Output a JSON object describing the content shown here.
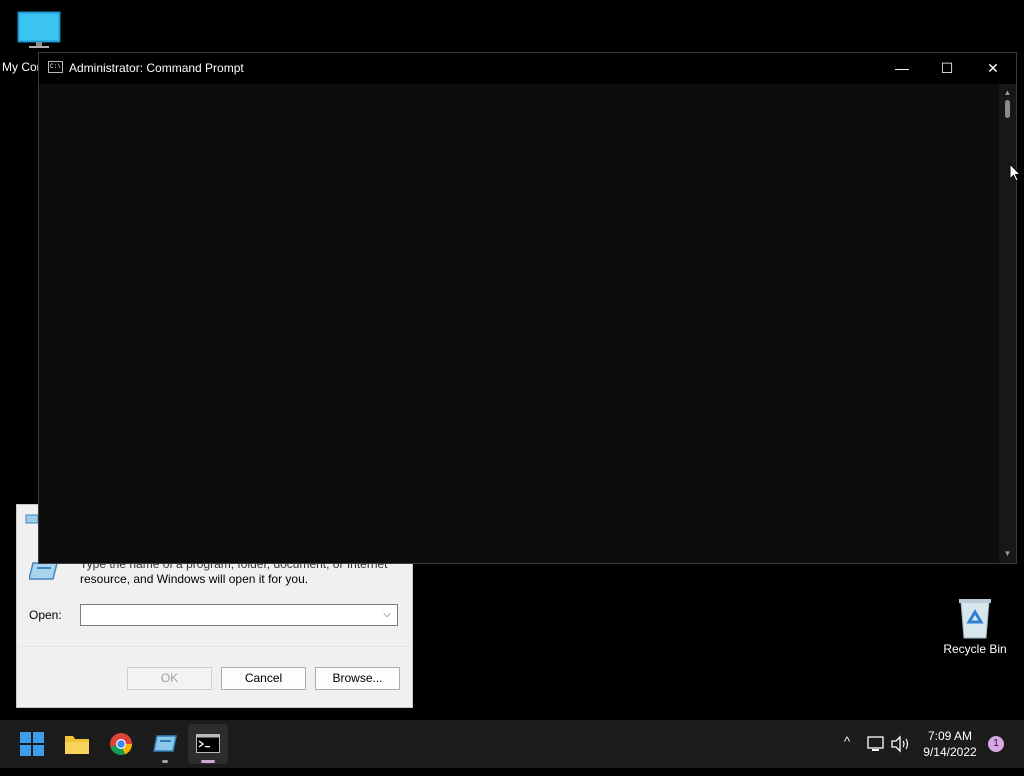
{
  "desktop": {
    "icons": [
      {
        "label": "My Computer"
      },
      {
        "label": "Recycle Bin"
      }
    ]
  },
  "run_dialog": {
    "description_line1": "Type the name of a program, folder, document, or Internet",
    "description_line2": "resource, and Windows will open it for you.",
    "open_label": "Open:",
    "open_value": "",
    "ok_label": "OK",
    "cancel_label": "Cancel",
    "browse_label": "Browse..."
  },
  "cmd_window": {
    "title": "Administrator: Command Prompt",
    "app_icon_text": "C:\\",
    "minimize_glyph": "—",
    "maximize_glyph": "☐",
    "close_glyph": "✕",
    "console_text": ""
  },
  "taskbar": {
    "apps": [
      {
        "icon": "windows-start-icon"
      },
      {
        "icon": "file-explorer-icon"
      },
      {
        "icon": "chrome-icon"
      },
      {
        "icon": "run-dialog-icon"
      },
      {
        "icon": "command-prompt-icon"
      }
    ],
    "tray": {
      "chevron_glyph": "^",
      "time": "7:09 AM",
      "date": "9/14/2022",
      "notification_count": "1"
    }
  },
  "colors": {
    "desktop_bg": "#000000",
    "taskbar_bg": "#1c1c1c",
    "console_bg": "#0c0c0c",
    "active_indicator": "#d59fe0"
  }
}
